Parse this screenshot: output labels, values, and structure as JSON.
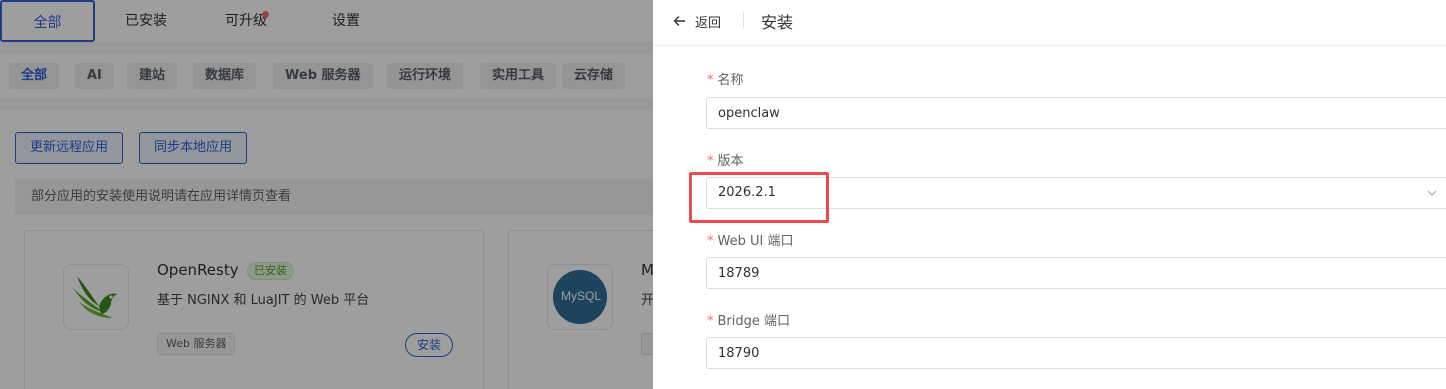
{
  "main_tabs": [
    {
      "label": "全部"
    },
    {
      "label": "已安装"
    },
    {
      "label": "可升级"
    },
    {
      "label": "设置"
    }
  ],
  "categories": [
    {
      "label": "全部"
    },
    {
      "label": "AI"
    },
    {
      "label": "建站"
    },
    {
      "label": "数据库"
    },
    {
      "label": "Web 服务器"
    },
    {
      "label": "运行环境"
    },
    {
      "label": "实用工具"
    },
    {
      "label": "云存储"
    }
  ],
  "actions": {
    "update_remote": "更新远程应用",
    "sync_local": "同步本地应用"
  },
  "notice": "部分应用的安装使用说明请在应用详情页查看",
  "apps": [
    {
      "name": "OpenResty",
      "installed_badge": "已安装",
      "description": "基于 NGINX 和 LuaJIT 的 Web 平台",
      "type": "Web 服务器",
      "install_label": "安装",
      "icon": "openresty-logo"
    },
    {
      "name": "M",
      "description": "开",
      "icon": "mysql-logo",
      "logo_text": "MySQL"
    }
  ],
  "drawer": {
    "back_label": "返回",
    "title": "安装",
    "fields": {
      "name": {
        "label": "名称",
        "value": "openclaw"
      },
      "version": {
        "label": "版本",
        "value": "2026.2.1"
      },
      "webui_port": {
        "label": "Web UI 端口",
        "value": "18789"
      },
      "bridge_port": {
        "label": "Bridge 端口",
        "value": "18790"
      }
    },
    "required_mark": "*"
  },
  "colors": {
    "accent": "#2f62d8",
    "required": "#f56c6c",
    "highlight": "#e84b4b",
    "installed": "#52a13a"
  }
}
